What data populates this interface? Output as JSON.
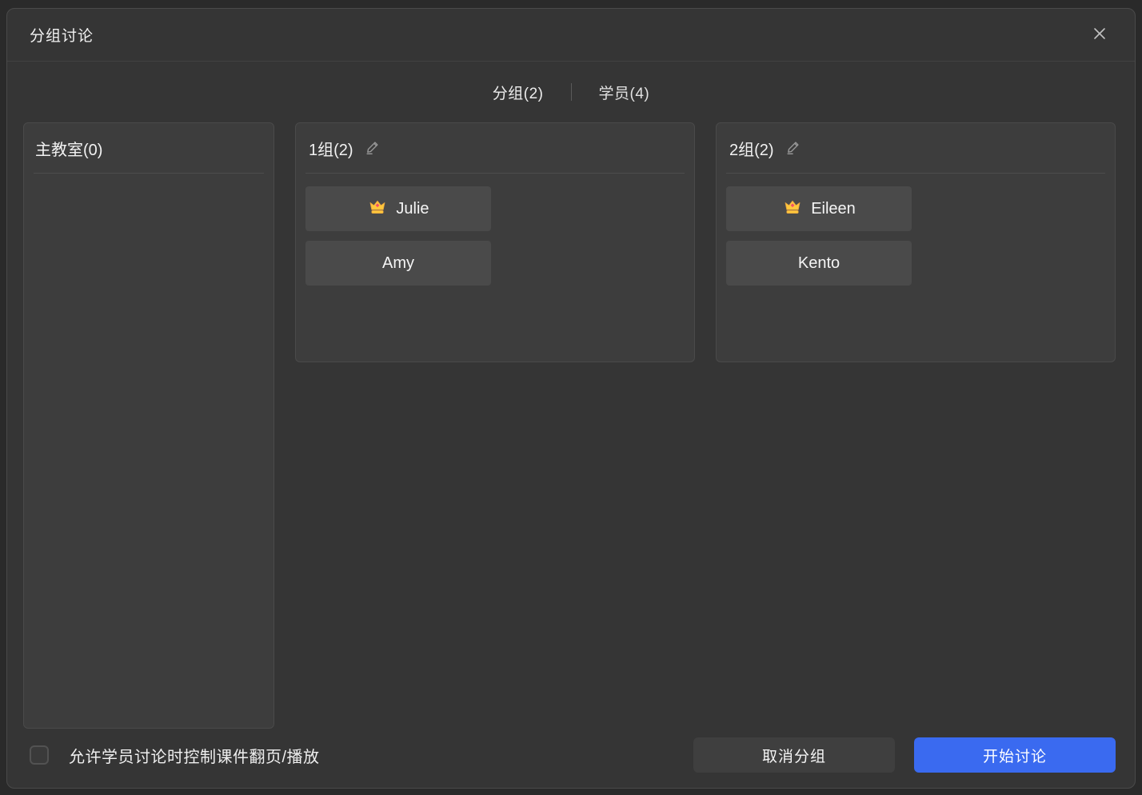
{
  "dialog": {
    "title": "分组讨论"
  },
  "icons": {
    "close": "x-icon",
    "edit": "pencil-icon",
    "leader": "crown-icon"
  },
  "tabs": {
    "groups_label": "分组(2)",
    "students_label": "学员(4)"
  },
  "main_room": {
    "title": "主教室(0)"
  },
  "groups": [
    {
      "name": "1组(2)",
      "members": [
        {
          "name": "Julie",
          "leader": true
        },
        {
          "name": "Amy",
          "leader": false
        }
      ]
    },
    {
      "name": "2组(2)",
      "members": [
        {
          "name": "Eileen",
          "leader": true
        },
        {
          "name": "Kento",
          "leader": false
        }
      ]
    }
  ],
  "footer": {
    "checkbox_label": "允许学员讨论时控制课件翻页/播放",
    "checkbox_checked": false,
    "cancel_label": "取消分组",
    "start_label": "开始讨论"
  },
  "colors": {
    "accent_blue": "#3a6af0",
    "crown_gold": "#ffc83d",
    "crown_gem": "#f25268",
    "dialog_bg": "#353535",
    "panel_bg": "#3d3d3d",
    "tile_bg": "#4a4a4a"
  }
}
